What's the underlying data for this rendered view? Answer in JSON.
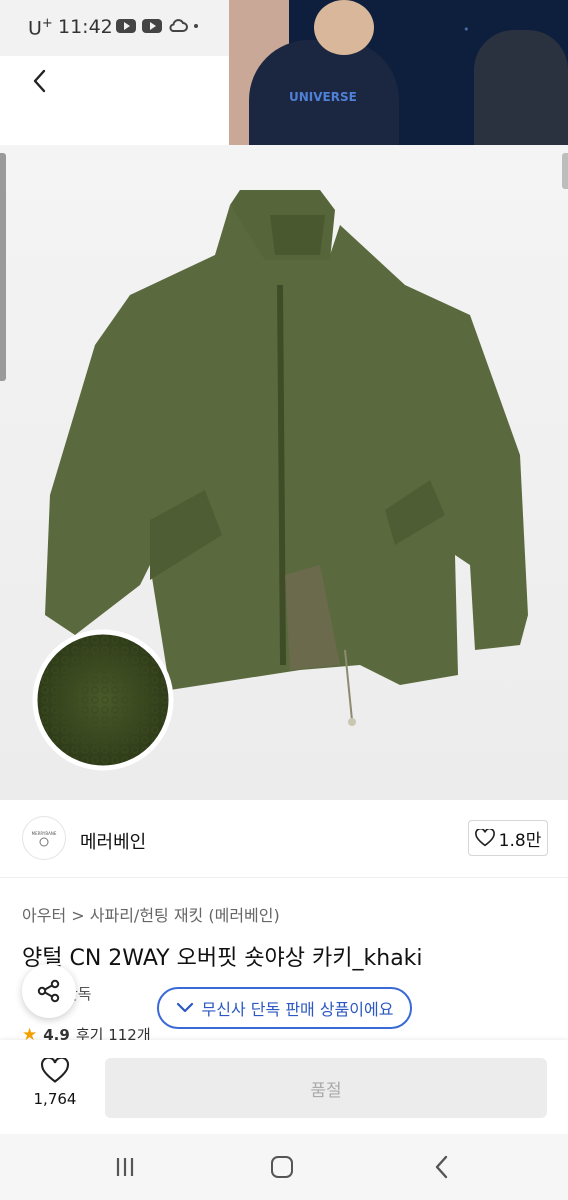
{
  "status_bar": {
    "carrier": "U",
    "carrier_sup": "+",
    "time": "11:42"
  },
  "pip_video": {
    "shirt_text": "UNIVERSE"
  },
  "product": {
    "image_alt": "khaki shearling 2-way overfit short jacket",
    "brand": {
      "name": "메러베인",
      "logo_text": "MERRYBANE"
    },
    "like_count": "1.8만",
    "breadcrumb": {
      "category": "아우터",
      "separator": ">",
      "subcategory": "사파리/헌팅 재킷 (메러베인)"
    },
    "title": "양털 CN 2WAY 오버핏 숏야상 카키_khaki",
    "exclusive_small": "단독",
    "exclusive_pill": "무신사 단독 판매 상품이에요",
    "rating": {
      "score": "4.9",
      "reviews": "후기 112개"
    }
  },
  "buy_bar": {
    "wish_count": "1,764",
    "soldout_label": "품절"
  },
  "colors": {
    "accent_blue": "#3a6ad6",
    "star": "#f4a100",
    "jacket": "#5b6a3e"
  }
}
